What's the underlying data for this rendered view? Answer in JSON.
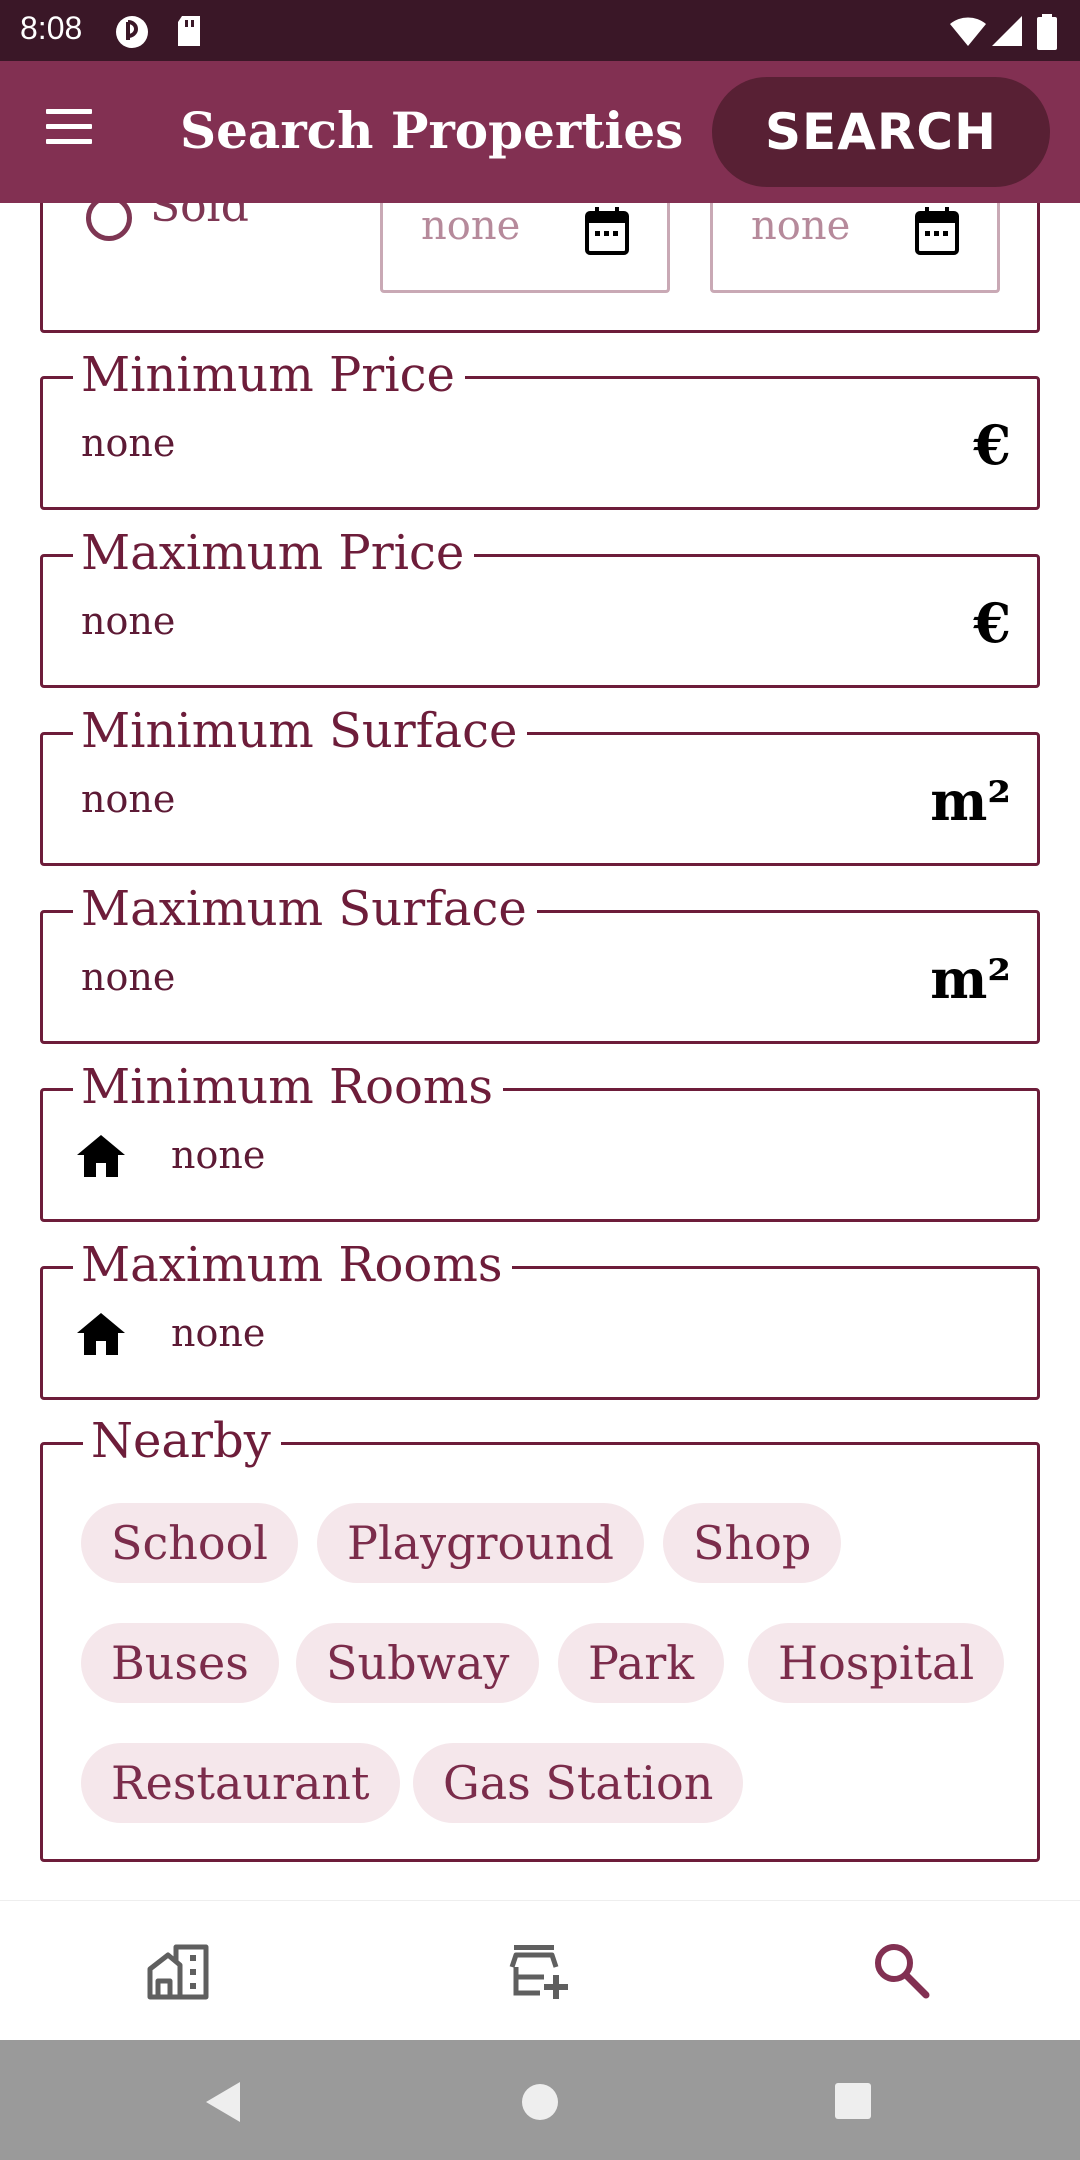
{
  "status_bar": {
    "time": "8:08"
  },
  "app_bar": {
    "title": "Search Properties",
    "search_label": "SEARCH"
  },
  "status_filter": {
    "sold_label": "Sold",
    "date_from": "none",
    "date_to": "none"
  },
  "fields": {
    "min_price": {
      "label": "Minimum Price",
      "value": "none",
      "suffix": "€"
    },
    "max_price": {
      "label": "Maximum Price",
      "value": "none",
      "suffix": "€"
    },
    "min_surface": {
      "label": "Minimum Surface",
      "value": "none",
      "suffix": "m²"
    },
    "max_surface": {
      "label": "Maximum Surface",
      "value": "none",
      "suffix": "m²"
    },
    "min_rooms": {
      "label": "Minimum Rooms",
      "value": "none",
      "icon": "home-icon"
    },
    "max_rooms": {
      "label": "Maximum Rooms",
      "value": "none",
      "icon": "home-icon"
    }
  },
  "nearby": {
    "label": "Nearby",
    "chips": [
      "School",
      "Playground",
      "Shop",
      "Buses",
      "Subway",
      "Park",
      "Hospital",
      "Restaurant",
      "Gas Station"
    ]
  },
  "bottom_nav": {
    "items": [
      {
        "icon": "properties-icon"
      },
      {
        "icon": "add-property-icon"
      },
      {
        "icon": "search-icon",
        "active": true
      }
    ]
  },
  "colors": {
    "app_bar": "#823052",
    "status_bar": "#3a1727",
    "accent": "#6d1d3a",
    "search_button": "#582034",
    "chip_bg": "#f5e7eb"
  }
}
